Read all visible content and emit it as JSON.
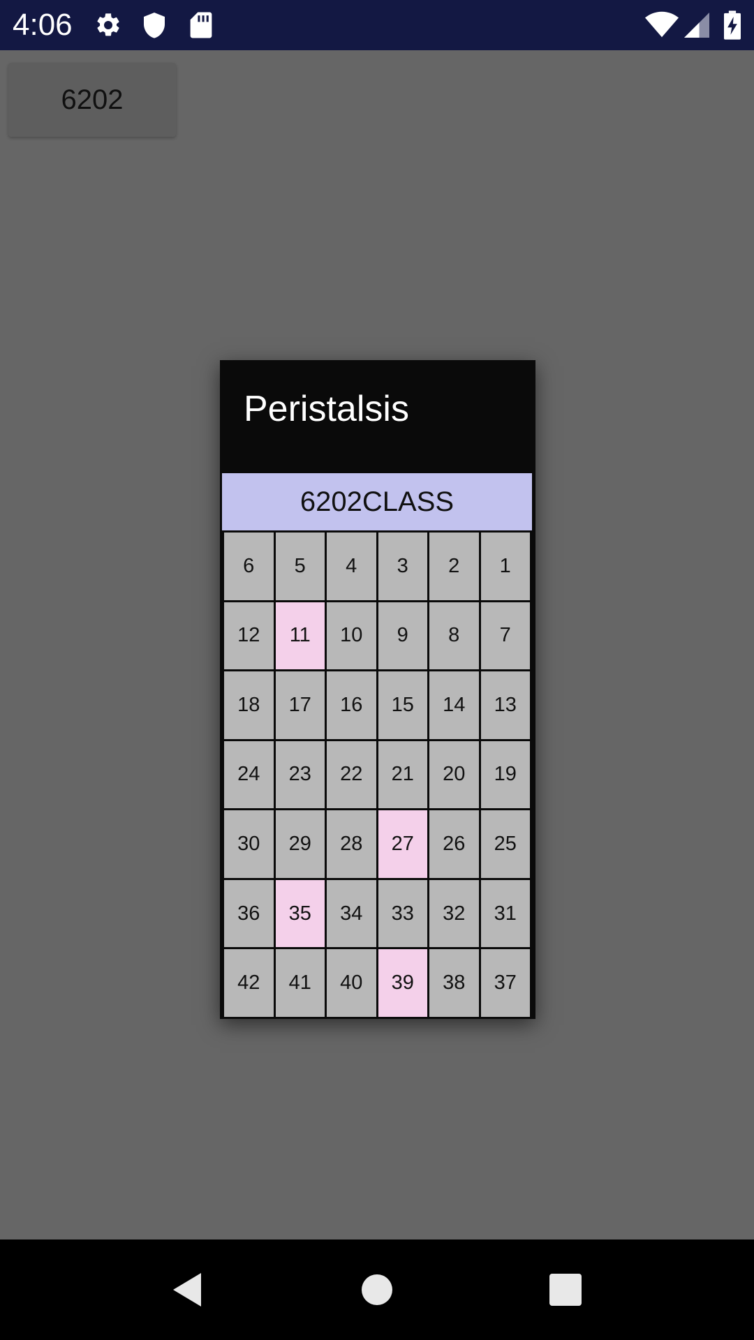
{
  "status_bar": {
    "time": "4:06",
    "icons": [
      "gear-icon",
      "shield-icon",
      "sd-card-icon",
      "wifi-icon",
      "signal-icon",
      "battery-charging-icon"
    ]
  },
  "app": {
    "top_button_label": "6202"
  },
  "dialog": {
    "title": "Peristalsis",
    "class_name": "6202CLASS",
    "seat_colors": {
      "default": "#b8b8b8",
      "highlight": "#f4d0ea"
    },
    "seats": [
      {
        "number": "6",
        "highlighted": false
      },
      {
        "number": "5",
        "highlighted": false
      },
      {
        "number": "4",
        "highlighted": false
      },
      {
        "number": "3",
        "highlighted": false
      },
      {
        "number": "2",
        "highlighted": false
      },
      {
        "number": "1",
        "highlighted": false
      },
      {
        "number": "12",
        "highlighted": false
      },
      {
        "number": "11",
        "highlighted": true
      },
      {
        "number": "10",
        "highlighted": false
      },
      {
        "number": "9",
        "highlighted": false
      },
      {
        "number": "8",
        "highlighted": false
      },
      {
        "number": "7",
        "highlighted": false
      },
      {
        "number": "18",
        "highlighted": false
      },
      {
        "number": "17",
        "highlighted": false
      },
      {
        "number": "16",
        "highlighted": false
      },
      {
        "number": "15",
        "highlighted": false
      },
      {
        "number": "14",
        "highlighted": false
      },
      {
        "number": "13",
        "highlighted": false
      },
      {
        "number": "24",
        "highlighted": false
      },
      {
        "number": "23",
        "highlighted": false
      },
      {
        "number": "22",
        "highlighted": false
      },
      {
        "number": "21",
        "highlighted": false
      },
      {
        "number": "20",
        "highlighted": false
      },
      {
        "number": "19",
        "highlighted": false
      },
      {
        "number": "30",
        "highlighted": false
      },
      {
        "number": "29",
        "highlighted": false
      },
      {
        "number": "28",
        "highlighted": false
      },
      {
        "number": "27",
        "highlighted": true
      },
      {
        "number": "26",
        "highlighted": false
      },
      {
        "number": "25",
        "highlighted": false
      },
      {
        "number": "36",
        "highlighted": false
      },
      {
        "number": "35",
        "highlighted": true
      },
      {
        "number": "34",
        "highlighted": false
      },
      {
        "number": "33",
        "highlighted": false
      },
      {
        "number": "32",
        "highlighted": false
      },
      {
        "number": "31",
        "highlighted": false
      },
      {
        "number": "42",
        "highlighted": false
      },
      {
        "number": "41",
        "highlighted": false
      },
      {
        "number": "40",
        "highlighted": false
      },
      {
        "number": "39",
        "highlighted": true
      },
      {
        "number": "38",
        "highlighted": false
      },
      {
        "number": "37",
        "highlighted": false
      }
    ]
  },
  "nav_bar": {
    "buttons": [
      "back-icon",
      "home-icon",
      "recents-icon"
    ]
  }
}
